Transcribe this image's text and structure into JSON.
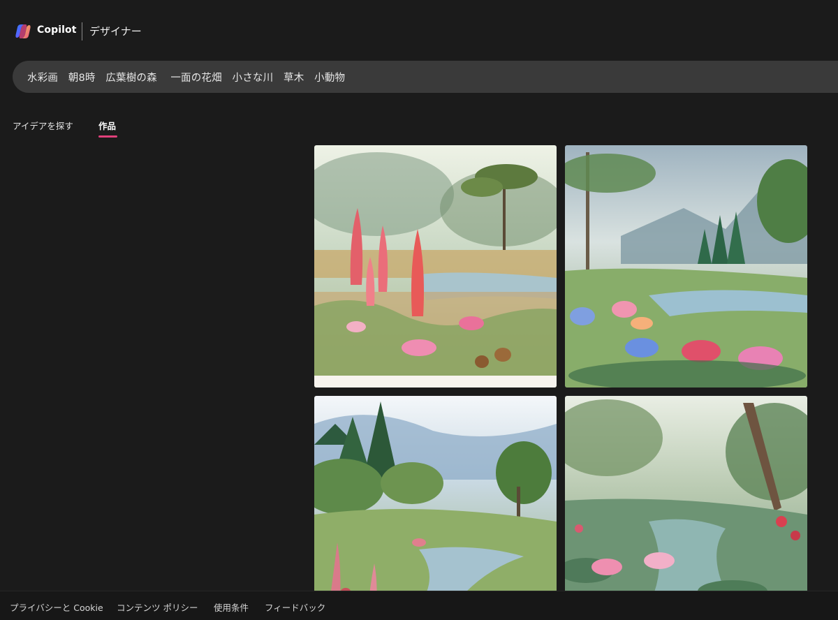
{
  "header": {
    "brand_name": "Copilot",
    "brand_product": "デザイナー",
    "accent_colors": [
      "#2e7dff",
      "#f2c94c",
      "#e84a8a",
      "#7c4dff"
    ]
  },
  "prompt": {
    "text": "水彩画　朝8時　広葉樹の森　 一面の花畑　小さな川　草木　小動物"
  },
  "tabs": [
    {
      "label": "アイデアを探す",
      "selected": false
    },
    {
      "label": "作品",
      "selected": true,
      "underline_color": "#e0407a"
    }
  ],
  "gallery": {
    "images": [
      {
        "name": "generated-image-1",
        "icon": "watercolor-meadow-image"
      },
      {
        "name": "generated-image-2",
        "icon": "watercolor-river-valley-image"
      },
      {
        "name": "generated-image-3",
        "icon": "watercolor-forest-stream-image"
      },
      {
        "name": "generated-image-4",
        "icon": "watercolor-lily-pond-image"
      }
    ]
  },
  "footer": {
    "privacy": "プライバシーと Cookie",
    "content_policy": "コンテンツ ポリシー",
    "terms": "使用条件",
    "feedback": "フィードバック"
  }
}
